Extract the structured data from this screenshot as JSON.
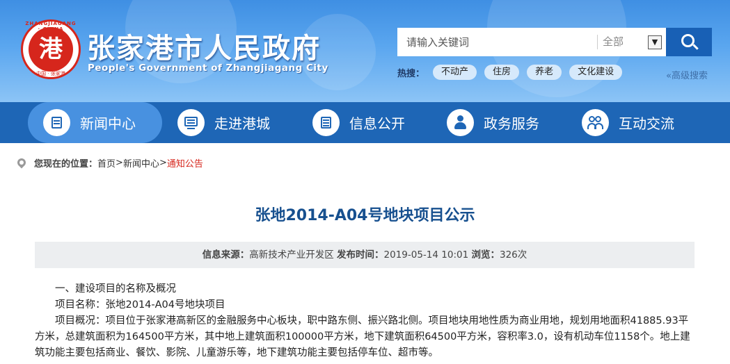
{
  "header": {
    "logo": {
      "ring_top": "ZHANGJIAGANG · CHINA",
      "ring_bottom": "中国 · 张家港",
      "mark": "港"
    },
    "title_cn": "张家港市人民政府",
    "title_en": "People's Government of Zhangjiagang City"
  },
  "search": {
    "placeholder": "请输入关键词",
    "scope": "全部",
    "dropdown_glyph": "▼"
  },
  "hot": {
    "label": "热搜：",
    "tags": [
      "不动产",
      "住房",
      "养老",
      "文化建设"
    ]
  },
  "advanced_search": "«高级搜索",
  "nav": {
    "items": [
      {
        "label": "新闻中心",
        "icon": "document-icon"
      },
      {
        "label": "走进港城",
        "icon": "screen-icon"
      },
      {
        "label": "信息公开",
        "icon": "list-icon"
      },
      {
        "label": "政务服务",
        "icon": "person-icon"
      },
      {
        "label": "互动交流",
        "icon": "users-icon"
      }
    ]
  },
  "breadcrumb": {
    "label": "您现在的位置：",
    "items": [
      "首页",
      "新闻中心",
      "通知公告"
    ],
    "sep": ">"
  },
  "article": {
    "title": "张地2014-A04号地块项目公示",
    "meta": {
      "source_label": "信息来源：",
      "source": "高新技术产业开发区",
      "time_label": "发布时间：",
      "time": "2019-05-14 10:01",
      "views_label": "浏览：",
      "views": "326次"
    },
    "paragraphs": [
      "一、建设项目的名称及概况",
      "项目名称：张地2014-A04号地块项目",
      "项目概况：项目位于张家港高新区的金融服务中心板块，职中路东侧、振兴路北侧。项目地块用地性质为商业用地，规划用地面积41885.93平方米，总建筑面积为164500平方米，其中地上建筑面积100000平方米，地下建筑面积64500平方米，容积率3.0，设有机动车位1158个。地上建筑功能主要包括商业、餐饮、影院、儿童游乐等，地下建筑功能主要包括停车位、超市等。"
    ]
  },
  "colors": {
    "nav_bg": "#1e66b6",
    "nav_active": "#4891e0",
    "title_blue": "#17508f",
    "crumb_current": "#d6261c"
  }
}
